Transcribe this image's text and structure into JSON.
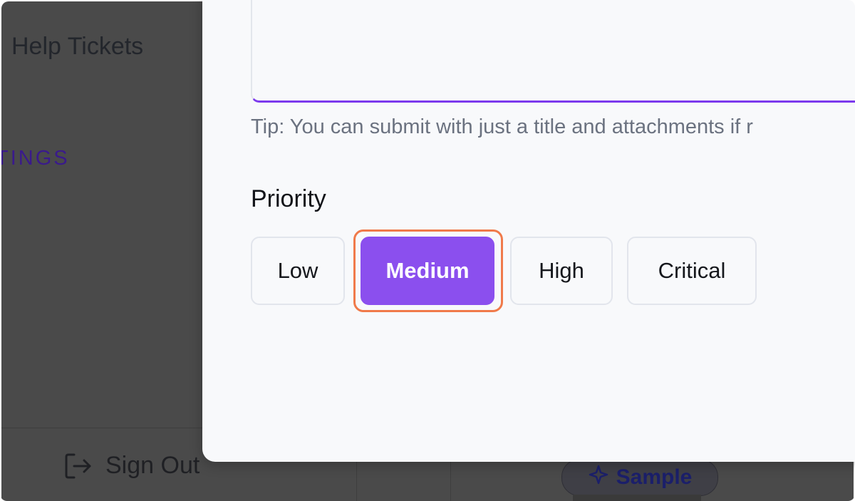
{
  "sidebar": {
    "title": "Help Tickets",
    "section_label": "TINGS",
    "sign_out_label": "Sign Out",
    "sign_out_icon": "sign-out-icon"
  },
  "footer": {
    "sample_chip_label": "Sample",
    "sample_chip_icon": "sparkles-icon"
  },
  "modal": {
    "tip_text": "Tip: You can submit with just a title and attachments if r",
    "priority": {
      "label": "Priority",
      "options": [
        {
          "label": "Low",
          "selected": false
        },
        {
          "label": "Medium",
          "selected": true
        },
        {
          "label": "High",
          "selected": false
        },
        {
          "label": "Critical",
          "selected": false
        }
      ]
    }
  },
  "colors": {
    "accent": "#8b4fee",
    "highlight": "#f07a4a",
    "textarea_focus": "#7c3aed",
    "overlay": "#4a4a4a"
  }
}
